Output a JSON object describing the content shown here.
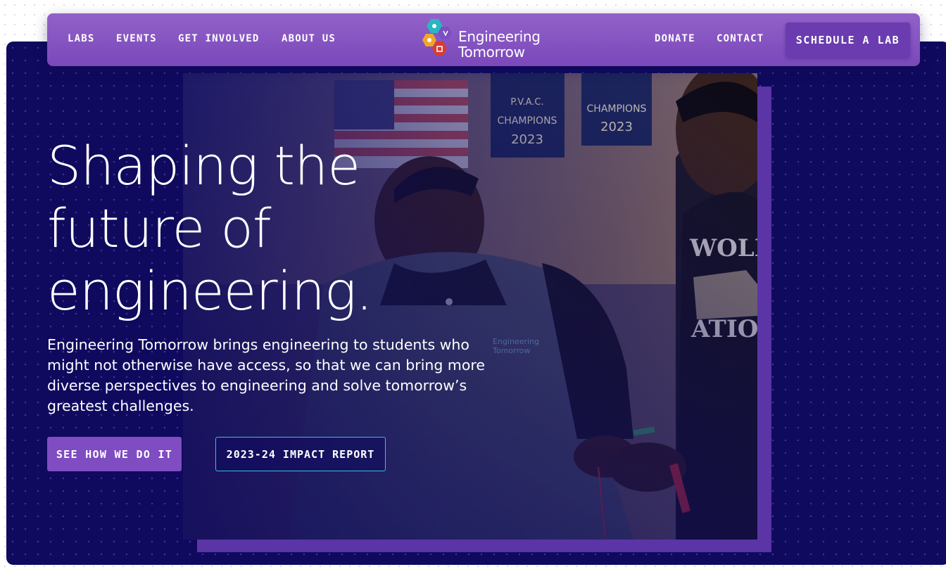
{
  "nav": {
    "left_links": [
      "LABS",
      "EVENTS",
      "GET INVOLVED",
      "ABOUT US"
    ],
    "right_links": [
      "DONATE",
      "CONTACT"
    ],
    "cta_label": "SCHEDULE A LAB",
    "logo": {
      "line1": "Engineering",
      "line2": "Tomorrow",
      "icon": "hexagon-cluster-logo-icon"
    }
  },
  "hero": {
    "headline_lines": [
      "Shaping the",
      "future of",
      "engineering."
    ],
    "subtext": "Engineering Tomorrow brings engineering to students who might not otherwise have access, so that we can bring more diverse perspectives to engineering and solve tomorrow’s greatest challenges.",
    "primary_button": "SEE HOW WE DO IT",
    "secondary_button": "2023-24 IMPACT REPORT",
    "photo_icon": "students-working-photo"
  },
  "colors": {
    "hero_background": "#0f0a5e",
    "nav_background": "#8a5cc6",
    "accent_purple": "#7f4cc2",
    "outline_teal": "#38c2d2"
  }
}
